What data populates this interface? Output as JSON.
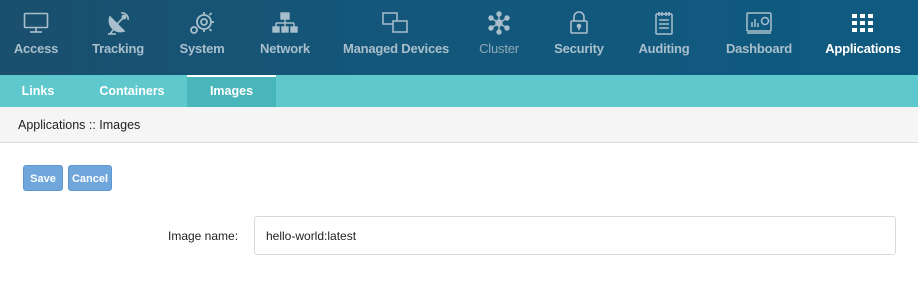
{
  "nav": {
    "items": [
      {
        "key": "access",
        "label": "Access"
      },
      {
        "key": "tracking",
        "label": "Tracking"
      },
      {
        "key": "system",
        "label": "System"
      },
      {
        "key": "network",
        "label": "Network"
      },
      {
        "key": "managed_devices",
        "label": "Managed Devices"
      },
      {
        "key": "cluster",
        "label": "Cluster"
      },
      {
        "key": "security",
        "label": "Security"
      },
      {
        "key": "auditing",
        "label": "Auditing"
      },
      {
        "key": "dashboard",
        "label": "Dashboard"
      },
      {
        "key": "applications",
        "label": "Applications"
      }
    ],
    "active": "applications",
    "disabled": "cluster",
    "icons": [
      "monitor-icon",
      "satellite-dish-icon",
      "gear-icon",
      "network-icon",
      "managed-devices-icon",
      "cluster-icon",
      "lock-icon",
      "clipboard-icon",
      "dashboard-icon",
      "apps-grid-icon"
    ]
  },
  "subnav": {
    "items": [
      {
        "label": "Links"
      },
      {
        "label": "Containers"
      },
      {
        "label": "Images"
      }
    ],
    "active": "Images"
  },
  "breadcrumb": "Applications :: Images",
  "actions": {
    "save_label": "Save",
    "cancel_label": "Cancel"
  },
  "form": {
    "image_name_label": "Image name:",
    "image_name_value": "hello-world:latest"
  },
  "colors": {
    "nav_background": "#14577a",
    "subnav_background": "#5ec8cc",
    "button": "#6fa6dc"
  }
}
